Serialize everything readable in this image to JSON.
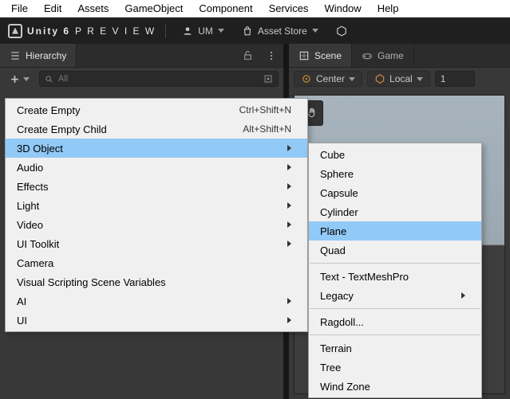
{
  "menubar": [
    "File",
    "Edit",
    "Assets",
    "GameObject",
    "Component",
    "Services",
    "Window",
    "Help"
  ],
  "topbar": {
    "product": "Unity 6",
    "edition": "P R E V I E W",
    "user": "UM",
    "store": "Asset Store"
  },
  "tabs": {
    "hierarchy": "Hierarchy",
    "scene": "Scene",
    "game": "Game"
  },
  "hier_toolbar": {
    "search_placeholder": "All"
  },
  "scene_toolbar": {
    "pivot": "Center",
    "space": "Local",
    "number": "1"
  },
  "ctx_main": [
    {
      "label": "Create Empty",
      "shortcut": "Ctrl+Shift+N",
      "sub": false
    },
    {
      "label": "Create Empty Child",
      "shortcut": "Alt+Shift+N",
      "sub": false
    },
    {
      "label": "3D Object",
      "shortcut": "",
      "sub": true,
      "highlight": true
    },
    {
      "label": "Audio",
      "shortcut": "",
      "sub": true
    },
    {
      "label": "Effects",
      "shortcut": "",
      "sub": true
    },
    {
      "label": "Light",
      "shortcut": "",
      "sub": true
    },
    {
      "label": "Video",
      "shortcut": "",
      "sub": true
    },
    {
      "label": "UI Toolkit",
      "shortcut": "",
      "sub": true
    },
    {
      "label": "Camera",
      "shortcut": "",
      "sub": false
    },
    {
      "label": "Visual Scripting Scene Variables",
      "shortcut": "",
      "sub": false
    },
    {
      "label": "AI",
      "shortcut": "",
      "sub": true
    },
    {
      "label": "UI",
      "shortcut": "",
      "sub": true
    }
  ],
  "ctx_sub": {
    "groups": [
      [
        "Cube",
        "Sphere",
        "Capsule",
        "Cylinder",
        "Plane",
        "Quad"
      ],
      [
        "Text - TextMeshPro",
        {
          "label": "Legacy",
          "sub": true
        }
      ],
      [
        "Ragdoll..."
      ],
      [
        "Terrain",
        "Tree",
        "Wind Zone"
      ]
    ],
    "highlight": "Plane"
  }
}
